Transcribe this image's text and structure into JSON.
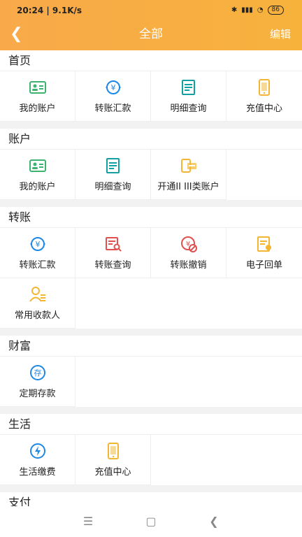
{
  "status_bar": {
    "time": "20:24 | 9.1K/s",
    "battery": "86"
  },
  "nav": {
    "back_icon": "back-arrow-icon",
    "title": "全部",
    "edit_label": "编辑"
  },
  "sections": [
    {
      "title": "首页",
      "items": [
        {
          "label": "我的账户",
          "icon": "id-card-icon"
        },
        {
          "label": "转账汇款",
          "icon": "transfer-yuan-icon"
        },
        {
          "label": "明细查询",
          "icon": "detail-list-icon"
        },
        {
          "label": "充值中心",
          "icon": "phone-recharge-icon"
        }
      ]
    },
    {
      "title": "账户",
      "items": [
        {
          "label": "我的账户",
          "icon": "id-card-icon"
        },
        {
          "label": "明细查询",
          "icon": "detail-list-icon"
        },
        {
          "label": "开通II III类账户",
          "icon": "open-account-icon"
        }
      ]
    },
    {
      "title": "转账",
      "items": [
        {
          "label": "转账汇款",
          "icon": "transfer-yuan-icon"
        },
        {
          "label": "转账查询",
          "icon": "transfer-query-icon"
        },
        {
          "label": "转账撤销",
          "icon": "transfer-cancel-icon"
        },
        {
          "label": "电子回单",
          "icon": "e-receipt-icon"
        },
        {
          "label": "常用收款人",
          "icon": "payee-icon"
        }
      ]
    },
    {
      "title": "财富",
      "items": [
        {
          "label": "定期存款",
          "icon": "deposit-icon"
        }
      ]
    },
    {
      "title": "生活",
      "items": [
        {
          "label": "生活缴费",
          "icon": "utility-payment-icon"
        },
        {
          "label": "充值中心",
          "icon": "phone-recharge-icon"
        }
      ]
    },
    {
      "title": "支付",
      "items": []
    }
  ],
  "colors": {
    "header": "#f9a94a",
    "green": "#3cb371",
    "blue": "#1e88e5",
    "teal": "#14a0a0",
    "red": "#e05050",
    "orange": "#f2b632"
  }
}
